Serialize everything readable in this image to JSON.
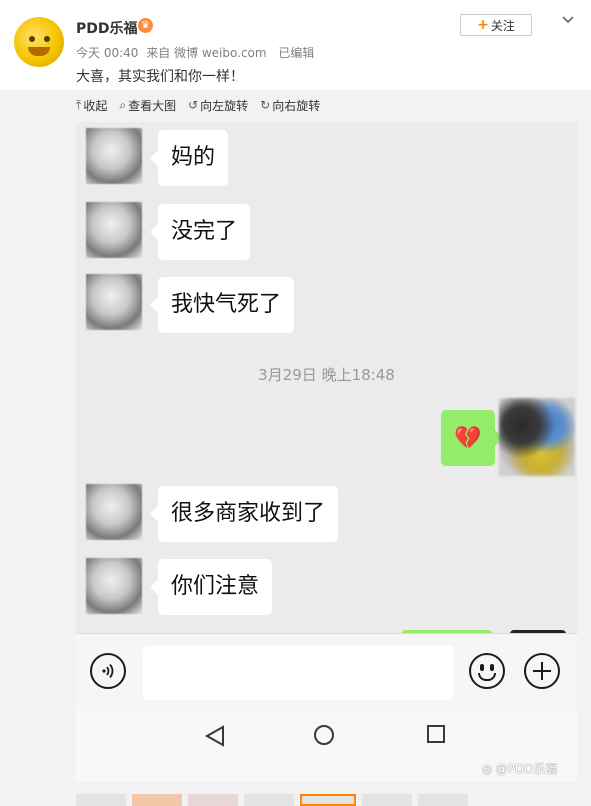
{
  "post": {
    "author": "PDD乐福",
    "badge_icon": "crown-emoji-icon",
    "time": "今天 00:40",
    "source": "来自 微博 weibo.com",
    "edited": "已编辑",
    "text": "大喜，其实我们和你一样！",
    "follow_label": "关注",
    "follow_icon": "plus-icon",
    "menu_icon": "chevron-down-icon"
  },
  "toolbar": {
    "collapse": "收起",
    "view_large": "查看大图",
    "rotate_left": "向左旋转",
    "rotate_right": "向右旋转"
  },
  "chat": {
    "messages": [
      {
        "side": "left",
        "text": "妈的"
      },
      {
        "side": "left",
        "text": "没完了"
      },
      {
        "side": "left",
        "text": "我快气死了"
      },
      {
        "side": "right",
        "emoji": "💔"
      },
      {
        "side": "left",
        "text": "很多商家收到了"
      },
      {
        "side": "left",
        "text": "你们注意"
      }
    ],
    "timestamp": "3月29日 晚上18:48"
  },
  "colors": {
    "accent": "#ff8200",
    "wechat_green": "#95ec69",
    "chat_bg": "#ebebeb"
  },
  "watermark": "@PDD乐福"
}
